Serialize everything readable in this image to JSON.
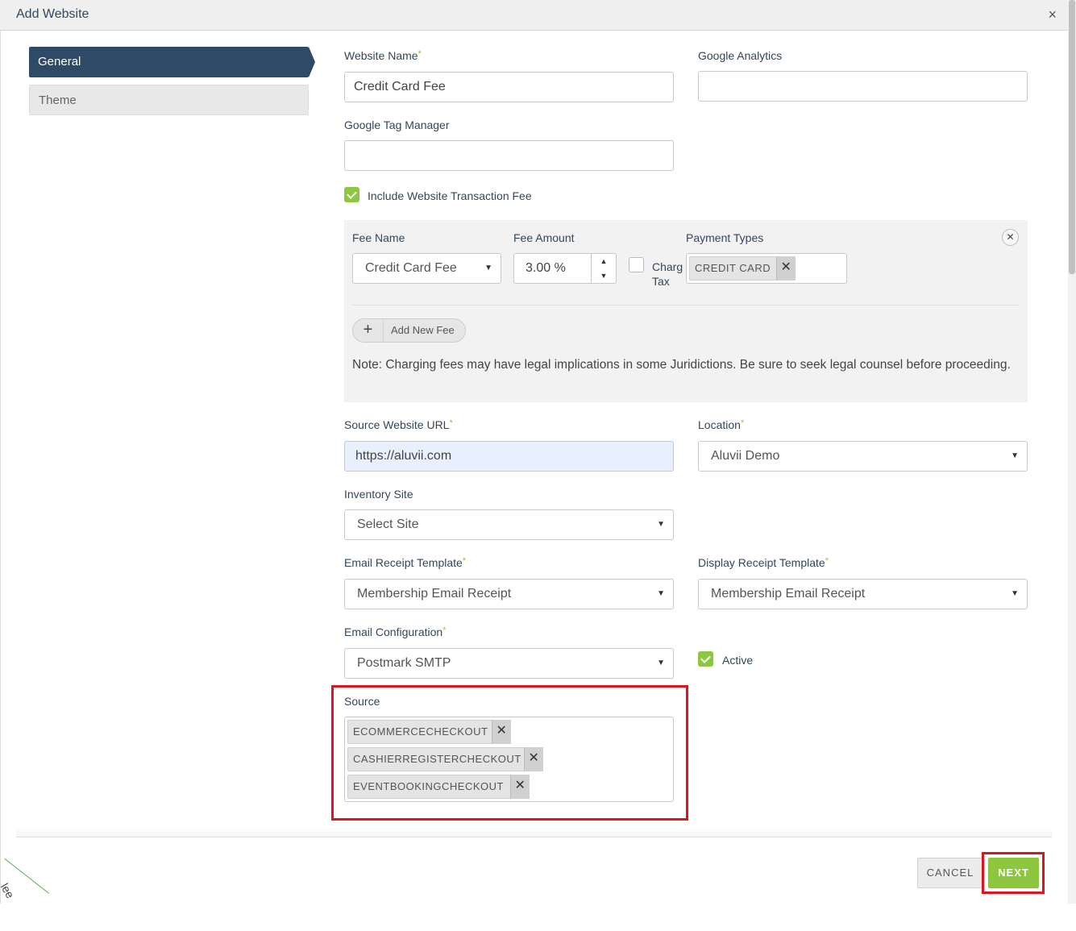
{
  "dialog": {
    "title": "Add Website",
    "close": "×"
  },
  "nav": {
    "general": "General",
    "theme": "Theme"
  },
  "fields": {
    "website_name_label": "Website Name",
    "website_name_value": "Credit Card Fee",
    "google_analytics_label": "Google Analytics",
    "google_analytics_value": "",
    "google_tag_manager_label": "Google Tag Manager",
    "google_tag_manager_value": "",
    "include_fee_label": "Include Website Transaction Fee",
    "source_url_label": "Source Website URL",
    "source_url_value": "https://aluvii.com",
    "location_label": "Location",
    "location_value": "Aluvii Demo",
    "inventory_site_label": "Inventory Site",
    "inventory_site_value": "Select Site",
    "email_receipt_label": "Email Receipt Template",
    "email_receipt_value": "Membership Email Receipt",
    "display_receipt_label": "Display Receipt Template",
    "display_receipt_value": "Membership Email Receipt",
    "email_config_label": "Email Configuration",
    "email_config_value": "Postmark SMTP",
    "active_label": "Active",
    "source_label": "Source",
    "required_mark": "*"
  },
  "fee": {
    "fee_name_label": "Fee Name",
    "fee_name_value": "Credit Card Fee",
    "fee_amount_label": "Fee Amount",
    "fee_amount_value": "3.00 %",
    "charge_tax_line1": "Charg",
    "charge_tax_line2": "Tax",
    "payment_types_label": "Payment Types",
    "payment_type_tag": "CREDIT CARD",
    "add_new_fee": "Add New Fee",
    "note": "Note: Charging fees may have legal implications in some Juridictions. Be sure to seek legal counsel before proceeding."
  },
  "source_tags": [
    "ECOMMERCECHECKOUT",
    "CASHIERREGISTERCHECKOUT",
    "EVENTBOOKINGCHECKOUT"
  ],
  "buttons": {
    "cancel": "CANCEL",
    "next": "NEXT"
  },
  "corner_text": "lee",
  "colors": {
    "accent": "#8dc63f",
    "nav_active": "#2e4a66",
    "highlight": "#e0141e"
  }
}
